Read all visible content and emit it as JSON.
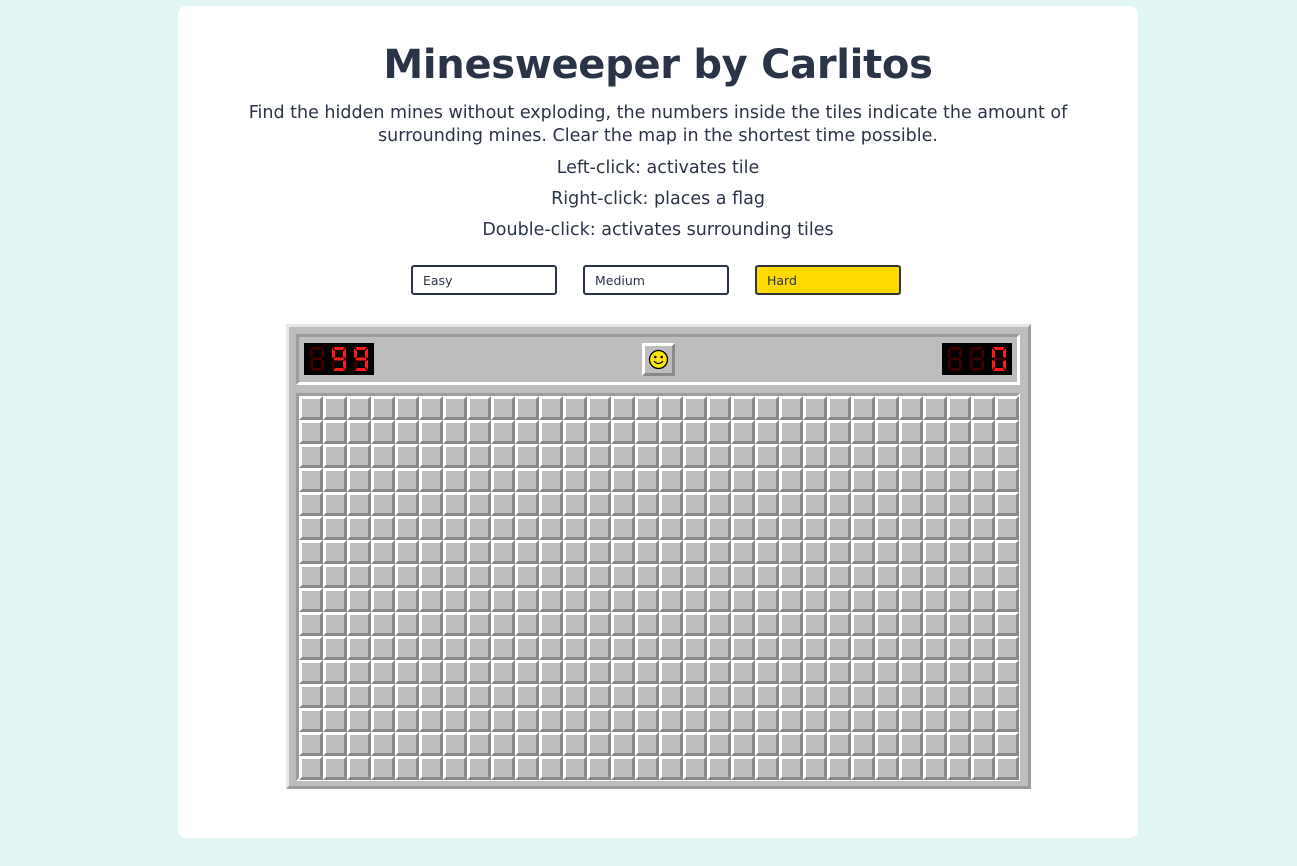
{
  "page": {
    "title": "Minesweeper by Carlitos",
    "description": "Find the hidden mines without exploding, the numbers inside the tiles indicate the amount of surrounding mines. Clear the map in the shortest time possible.",
    "instructions": [
      "Left-click: activates tile",
      "Right-click: places a flag",
      "Double-click: activates surrounding tiles"
    ]
  },
  "difficulty": {
    "options": [
      "Easy",
      "Medium",
      "Hard"
    ],
    "selected": "Hard"
  },
  "game": {
    "mine_counter": "099",
    "timer": "000",
    "face_icon": "smiley-face-icon",
    "board": {
      "rows": 16,
      "columns": 30,
      "state": "all-unrevealed"
    }
  },
  "colors": {
    "background": "#e0f5f4",
    "card": "#ffffff",
    "text": "#2b3447",
    "selected_button": "#ffd900",
    "tile_gray": "#bdbdbd",
    "lcd_on": "#ff1a1a",
    "lcd_off": "#3a0000"
  }
}
